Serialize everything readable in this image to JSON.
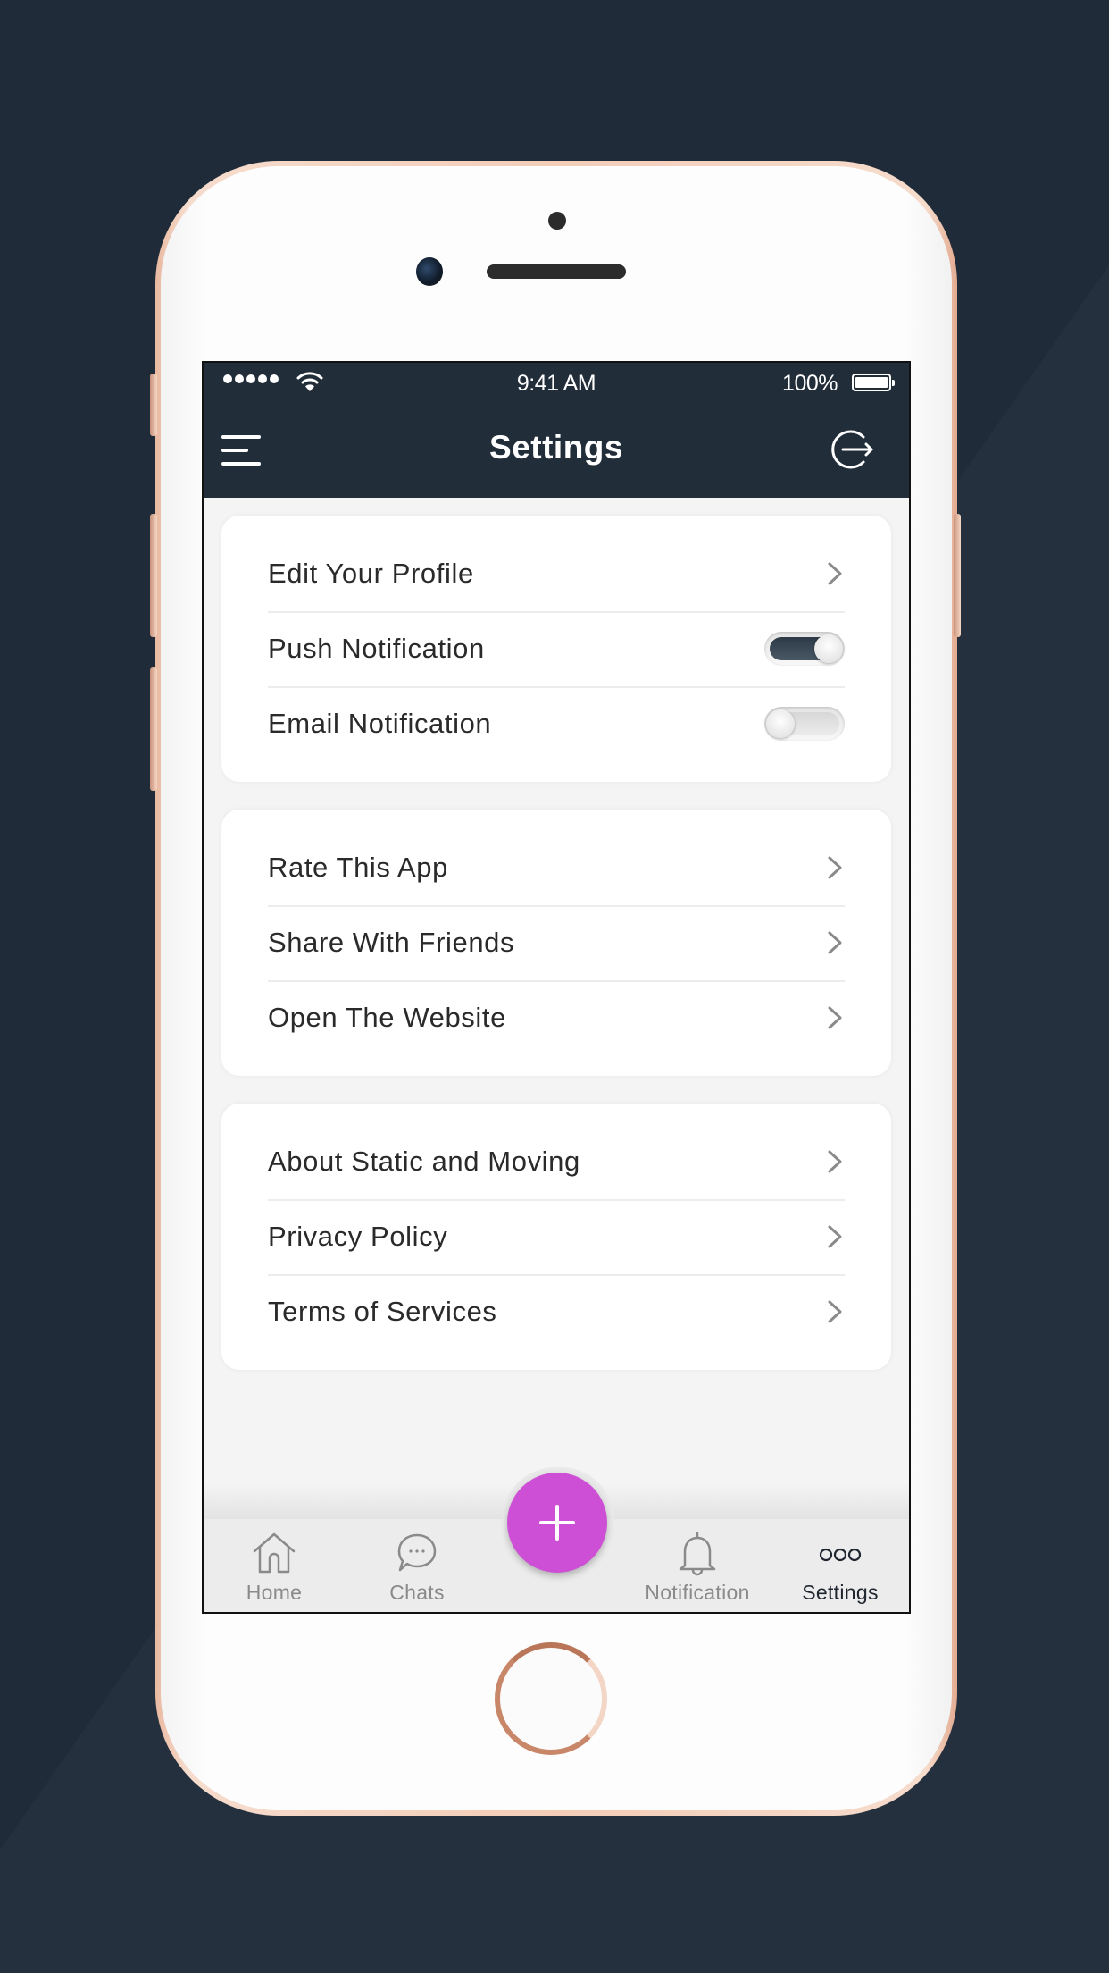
{
  "status_bar": {
    "signal_bars": 5,
    "time": "9:41 AM",
    "battery_percent": "100%",
    "battery_level": 1.0
  },
  "nav": {
    "title": "Settings",
    "left_icon": "menu-icon",
    "right_icon": "logout-icon"
  },
  "groups": [
    {
      "items": [
        {
          "label": "Edit Your Profile",
          "type": "link"
        },
        {
          "label": "Push Notification",
          "type": "toggle",
          "value": true
        },
        {
          "label": "Email Notification",
          "type": "toggle",
          "value": false
        }
      ]
    },
    {
      "items": [
        {
          "label": "Rate This App",
          "type": "link"
        },
        {
          "label": "Share With Friends",
          "type": "link"
        },
        {
          "label": "Open The Website",
          "type": "link"
        }
      ]
    },
    {
      "items": [
        {
          "label": "About Static and Moving",
          "type": "link"
        },
        {
          "label": "Privacy Policy",
          "type": "link"
        },
        {
          "label": "Terms of Services",
          "type": "link"
        }
      ]
    }
  ],
  "tabs": [
    {
      "label": "Home",
      "icon": "home-icon",
      "active": false
    },
    {
      "label": "Chats",
      "icon": "chat-bubble-icon",
      "active": false
    },
    {
      "label": "Notification",
      "icon": "bell-icon",
      "active": false
    },
    {
      "label": "Settings",
      "icon": "more-dots-icon",
      "active": true
    }
  ],
  "fab": {
    "icon": "plus-icon",
    "color": "#cd4fd5"
  },
  "colors": {
    "header": "#222d3a",
    "background": "#1f2b39",
    "accent": "#cd4fd5",
    "toggle_on": "#2c3a48"
  }
}
